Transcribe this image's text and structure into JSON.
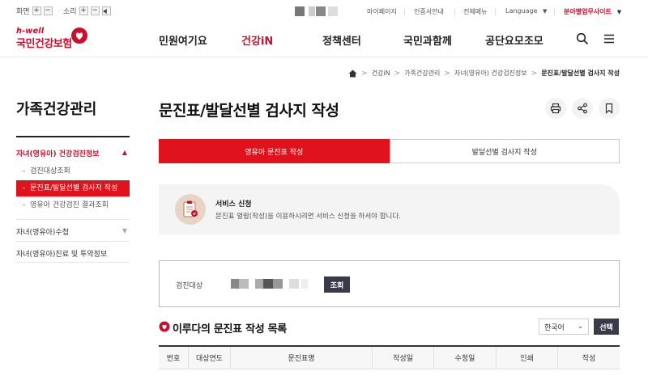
{
  "util": {
    "screen_label": "화면",
    "plus": "+",
    "minus": "−",
    "sound_label": "소리",
    "mypage": "마이페이지",
    "cert": "인증서안내",
    "allmenu": "전체메뉴",
    "language": "Language",
    "lang_caret": "▼",
    "business": "분야별업무사이트",
    "business_caret": "▼"
  },
  "logo": {
    "tagline": "h-well",
    "name": "국민건강보험"
  },
  "gnb": [
    {
      "label": "민원여기요"
    },
    {
      "label": "건강iN"
    },
    {
      "label": "정책센터"
    },
    {
      "label": "국민과함께"
    },
    {
      "label": "공단요모조모"
    }
  ],
  "breadcrumb": [
    "건강iN",
    "가족건강관리",
    "자녀(영유아) 건강검진정보",
    "문진표/발달선별 검사지 작성"
  ],
  "breadcrumb_sep": ">",
  "lnb": {
    "title": "가족건강관리",
    "items": [
      {
        "label": "자녀(영유아) 건강검진정보",
        "caret": "▲"
      },
      {
        "label": "자녀(영유아)수첩",
        "caret": "▼"
      },
      {
        "label": "자녀(영유아)진료 및 투약정보"
      }
    ],
    "subitems": [
      {
        "label": "검진대상조회"
      },
      {
        "label": "문진표/발달선별 검사지 작성"
      },
      {
        "label": "영유아 건강검진 결과조회"
      }
    ],
    "sub_prefix": "-"
  },
  "page": {
    "title": "문진표/발달선별 검사지 작성"
  },
  "tabs": [
    {
      "label": "영유아 문진표 작성"
    },
    {
      "label": "발달선별 검사지 작성"
    }
  ],
  "info": {
    "title": "서비스 신청",
    "desc": "문진표 열람(작성)을 이용하시려면 서비스 신청을 하셔야 합니다."
  },
  "search": {
    "label": "검진대상",
    "button": "조회"
  },
  "list": {
    "title": "이루다의 문진표 작성 목록",
    "language_value": "한국어",
    "language_caret": "⌄",
    "select_button": "선택",
    "columns": [
      "번호",
      "대상연도",
      "문진표명",
      "작성일",
      "수정일",
      "인쇄",
      "작성"
    ]
  },
  "colors": {
    "accent": "#e0121b",
    "brand": "#c8102e",
    "dark_button": "#3a3a4a"
  }
}
